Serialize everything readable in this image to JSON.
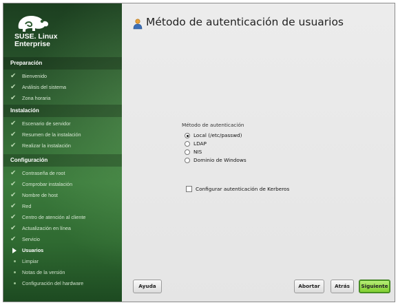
{
  "brand": {
    "line1": "SUSE. Linux",
    "line2": "Enterprise",
    "logo_icon": "suse-chameleon-icon"
  },
  "sidebar": {
    "sections": [
      {
        "title": "Preparación",
        "steps": [
          {
            "label": "Bienvenido",
            "state": "done"
          },
          {
            "label": "Análisis del sistema",
            "state": "done"
          },
          {
            "label": "Zona horaria",
            "state": "done"
          }
        ]
      },
      {
        "title": "Instalación",
        "steps": [
          {
            "label": "Escenario de servidor",
            "state": "done"
          },
          {
            "label": "Resumen de la instalación",
            "state": "done"
          },
          {
            "label": "Realizar la instalación",
            "state": "done"
          }
        ]
      },
      {
        "title": "Configuración",
        "steps": [
          {
            "label": "Contraseña de root",
            "state": "done"
          },
          {
            "label": "Comprobar instalación",
            "state": "done"
          },
          {
            "label": "Nombre de host",
            "state": "done"
          },
          {
            "label": "Red",
            "state": "done"
          },
          {
            "label": "Centro de atención al cliente",
            "state": "done"
          },
          {
            "label": "Actualización en línea",
            "state": "done"
          },
          {
            "label": "Servicio",
            "state": "done"
          },
          {
            "label": "Usuarios",
            "state": "current"
          },
          {
            "label": "Limpiar",
            "state": "todo"
          },
          {
            "label": "Notas de la versión",
            "state": "todo"
          },
          {
            "label": "Configuración del hardware",
            "state": "todo"
          }
        ]
      }
    ]
  },
  "main": {
    "title": "Método de autenticación de usuarios",
    "title_icon": "users-icon",
    "auth_group_label": "Método de autenticación",
    "options": [
      {
        "label": "Local (/etc/passwd)",
        "checked": true
      },
      {
        "label": "LDAP",
        "checked": false
      },
      {
        "label": "NIS",
        "checked": false
      },
      {
        "label": "Dominio de Windows",
        "checked": false
      }
    ],
    "kerberos_label": "Configurar autenticación de Kerberos",
    "kerberos_checked": false
  },
  "buttons": {
    "help": "Ayuda",
    "abort": "Abortar",
    "back": "Atrás",
    "next": "Siguiente"
  },
  "colors": {
    "sidebar_green": "#2c5a2f",
    "accent_button": "#7fce2e"
  }
}
